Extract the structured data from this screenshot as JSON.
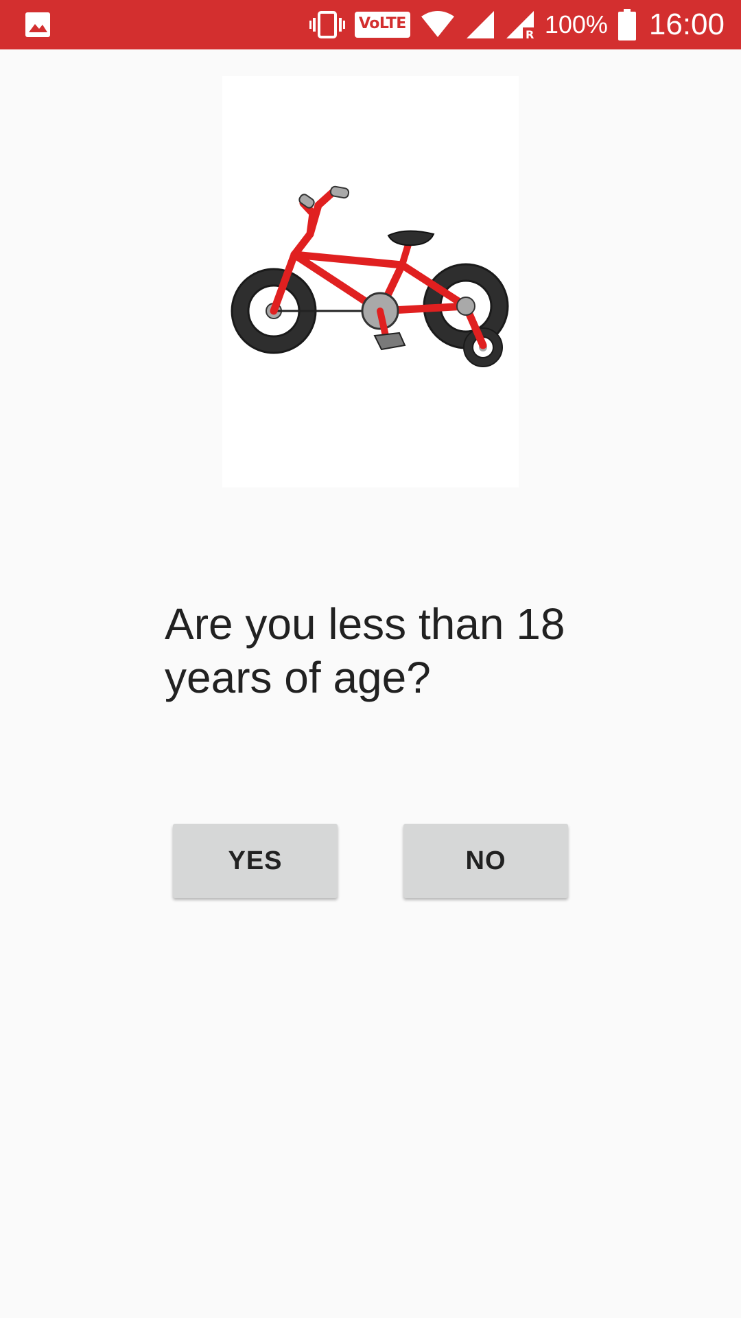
{
  "status_bar": {
    "background_color": "#d32f2f",
    "left_icon": "image-notification-icon",
    "network_label": "VoLTE",
    "battery_percent": "100%",
    "time": "16:00",
    "icons": [
      "vibrate-icon",
      "volte-icon",
      "wifi-icon",
      "cell-signal-icon",
      "cell-signal-roaming-icon",
      "battery-icon"
    ]
  },
  "illustration": {
    "icon": "bicycle-icon",
    "bike_color": "#e02020"
  },
  "question": {
    "text": "Are you less than 18 years of age?"
  },
  "answers": {
    "yes_label": "YES",
    "no_label": "NO"
  }
}
